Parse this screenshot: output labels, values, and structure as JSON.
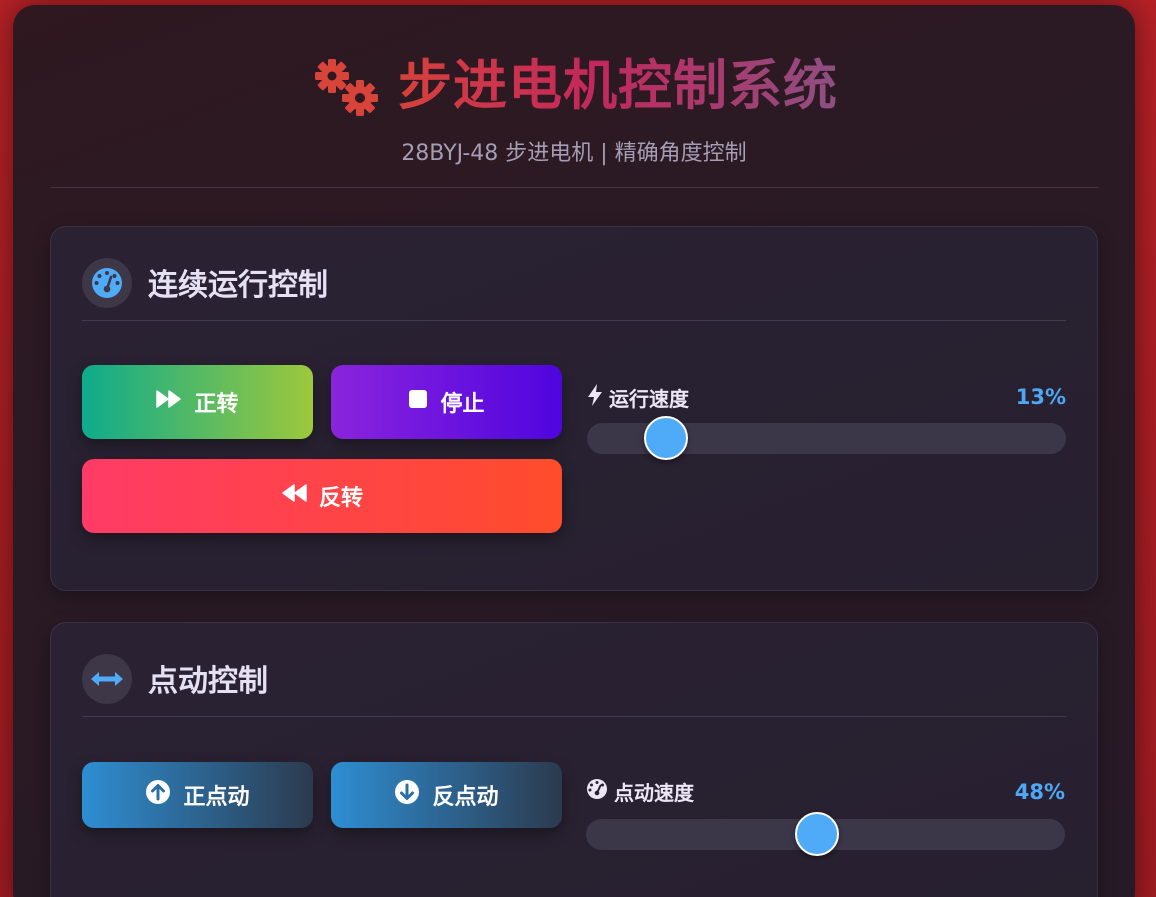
{
  "header": {
    "title": "步进电机控制系统",
    "subtitle": "28BYJ-48 步进电机 | 精确角度控制",
    "icon": "gears-icon"
  },
  "continuous": {
    "title": "连续运行控制",
    "icon": "speedometer-icon",
    "forward_label": "正转",
    "stop_label": "停止",
    "reverse_label": "反转",
    "speed_label": "运行速度",
    "speed_value": "13%",
    "speed_percent": 13
  },
  "jog": {
    "title": "点动控制",
    "icon": "arrows-horizontal-icon",
    "forward_label": "正点动",
    "reverse_label": "反点动",
    "speed_label": "点动速度",
    "speed_value": "48%",
    "speed_percent": 48
  },
  "colors": {
    "accent": "#4faaf8",
    "background": "#b52126",
    "card": "#2a2233"
  }
}
